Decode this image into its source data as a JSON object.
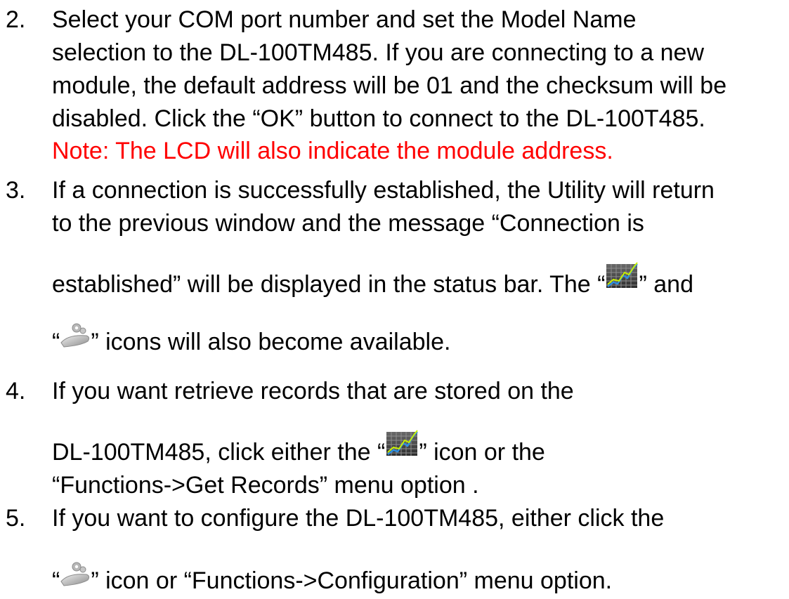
{
  "colors": {
    "text": "#000000",
    "note": "#ff0000"
  },
  "icons": {
    "chart": "chart-grid-icon",
    "config": "gear-wrench-icon"
  },
  "steps": [
    {
      "number": "2.",
      "lines": [
        "Select your COM port number and set the Model Name",
        "selection to the DL-100TM485. If you are connecting to a new",
        "module, the default address will be 01 and the checksum will be",
        "disabled. Click the “OK” button to connect to the DL-100T485."
      ],
      "note": "Note: The LCD will also indicate the module address."
    },
    {
      "number": "3.",
      "line1": "If a connection is successfully established, the Utility will return",
      "line2": "to the previous window and the message “Connection is",
      "line3_before": "established” will be displayed in the status bar. The “",
      "line3_after": "” and",
      "line4_before": "“",
      "line4_after": "” icons will also become available."
    },
    {
      "number": "4.",
      "line1": "If you want retrieve records that are stored on the",
      "line2_before": "DL-100TM485, click either the “",
      "line2_after": "” icon or the",
      "line3": "“Functions->Get Records” menu option ."
    },
    {
      "number": "5.",
      "line1": "If you want to configure the DL-100TM485, either click the",
      "line2_before": "“",
      "line2_after": "” icon or “Functions->Configuration” menu option."
    }
  ]
}
